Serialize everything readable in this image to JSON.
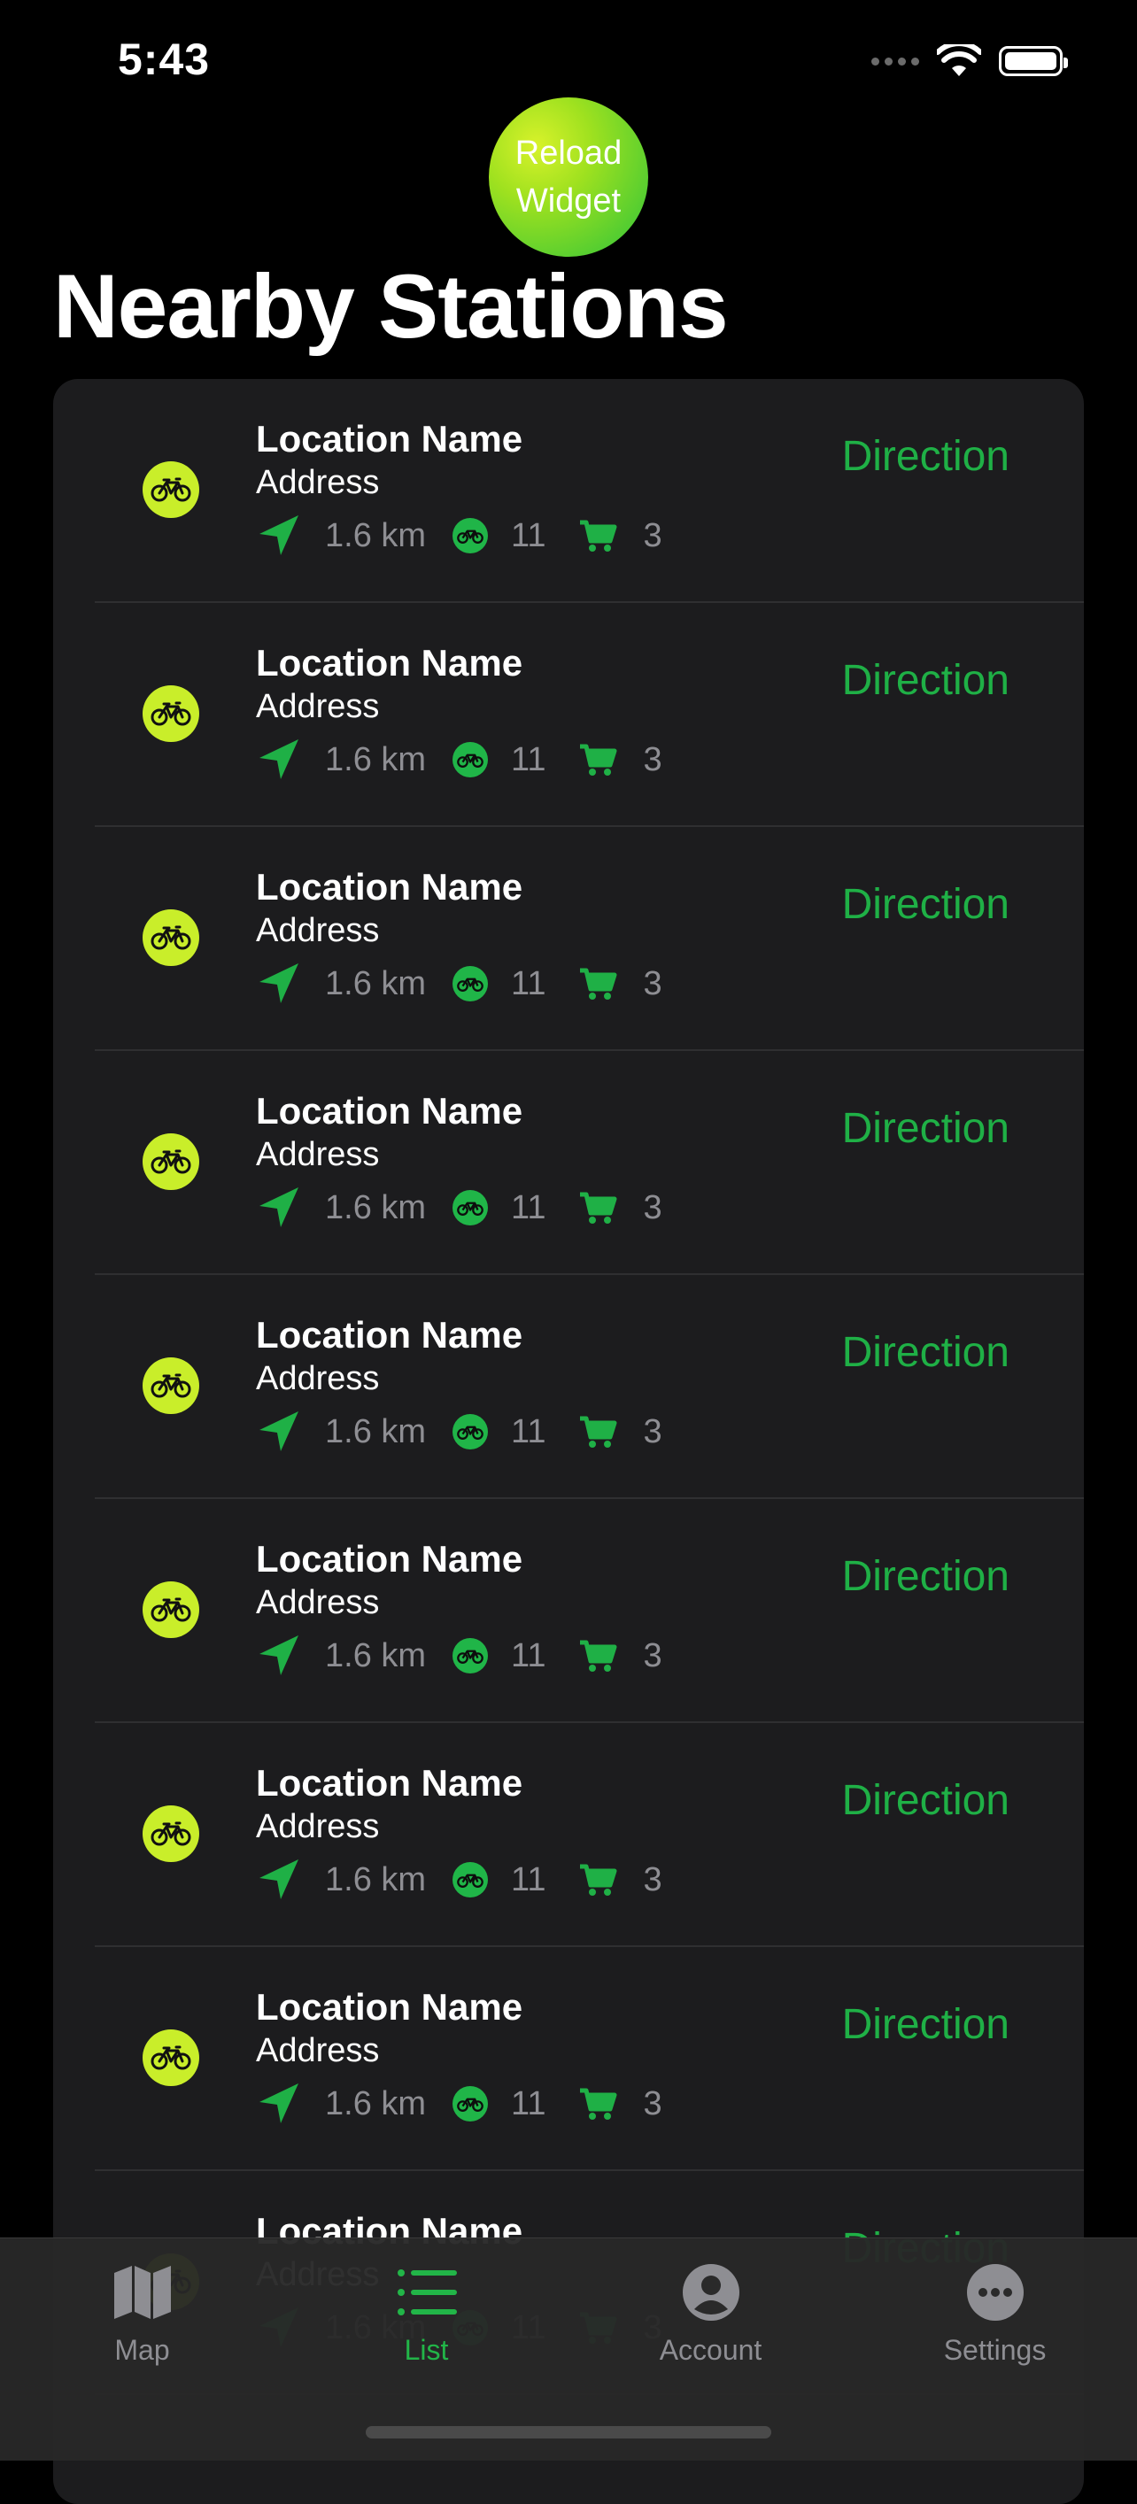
{
  "status_bar": {
    "time": "5:43"
  },
  "reload_widget": {
    "line1": "Reload",
    "line2": "Widget"
  },
  "page_title": "Nearby Stations",
  "stations": [
    {
      "name": "Location Name",
      "address": "Address",
      "distance": "1.6 km",
      "bikes": "11",
      "docks": "3",
      "action": "Direction"
    },
    {
      "name": "Location Name",
      "address": "Address",
      "distance": "1.6 km",
      "bikes": "11",
      "docks": "3",
      "action": "Direction"
    },
    {
      "name": "Location Name",
      "address": "Address",
      "distance": "1.6 km",
      "bikes": "11",
      "docks": "3",
      "action": "Direction"
    },
    {
      "name": "Location Name",
      "address": "Address",
      "distance": "1.6 km",
      "bikes": "11",
      "docks": "3",
      "action": "Direction"
    },
    {
      "name": "Location Name",
      "address": "Address",
      "distance": "1.6 km",
      "bikes": "11",
      "docks": "3",
      "action": "Direction"
    },
    {
      "name": "Location Name",
      "address": "Address",
      "distance": "1.6 km",
      "bikes": "11",
      "docks": "3",
      "action": "Direction"
    },
    {
      "name": "Location Name",
      "address": "Address",
      "distance": "1.6 km",
      "bikes": "11",
      "docks": "3",
      "action": "Direction"
    },
    {
      "name": "Location Name",
      "address": "Address",
      "distance": "1.6 km",
      "bikes": "11",
      "docks": "3",
      "action": "Direction"
    },
    {
      "name": "Location Name",
      "address": "Address",
      "distance": "1.6 km",
      "bikes": "11",
      "docks": "3",
      "action": "Direction"
    }
  ],
  "tabs": [
    {
      "label": "Map",
      "icon": "map-icon",
      "active": false
    },
    {
      "label": "List",
      "icon": "list-icon",
      "active": true
    },
    {
      "label": "Account",
      "icon": "account-icon",
      "active": false
    },
    {
      "label": "Settings",
      "icon": "settings-icon",
      "active": false
    }
  ],
  "colors": {
    "accent": "#1fb046",
    "station_icon": "#c9ee2a",
    "card": "#1c1c1e"
  }
}
